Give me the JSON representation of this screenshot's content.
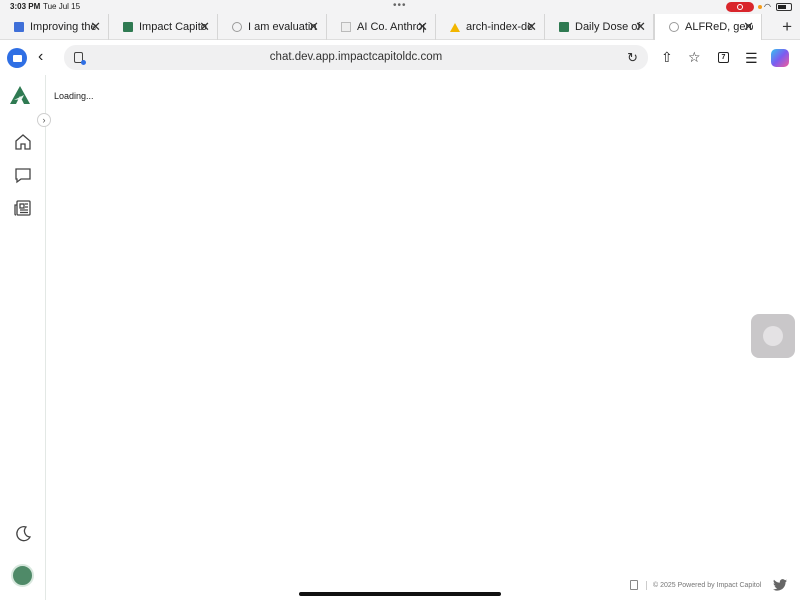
{
  "status_bar": {
    "time": "3:03 PM",
    "date": "Tue Jul 15"
  },
  "tabs": [
    {
      "title": "Improving the",
      "icon": "doc-icon",
      "active": false
    },
    {
      "title": "Impact Capitol",
      "icon": "impact-logo-icon",
      "active": false
    },
    {
      "title": "I am evaluating",
      "icon": "globe-icon",
      "active": false
    },
    {
      "title": "AI Co. Anthropic",
      "icon": "ai-site-icon",
      "active": false
    },
    {
      "title": "arch-index-de",
      "icon": "drive-icon",
      "active": false
    },
    {
      "title": "Daily Dose of",
      "icon": "impact-logo-icon",
      "active": false
    },
    {
      "title": "ALFReD, generative",
      "icon": "globe-icon",
      "active": true
    }
  ],
  "toolbar": {
    "url": "chat.dev.app.impactcapitoldc.com",
    "tab_count": "7"
  },
  "colors": {
    "brand": "#2f7a52",
    "accent": "#2f6fe4"
  },
  "app": {
    "loading_text": "Loading...",
    "footer_text": "© 2025 Powered by Impact Capitol"
  }
}
